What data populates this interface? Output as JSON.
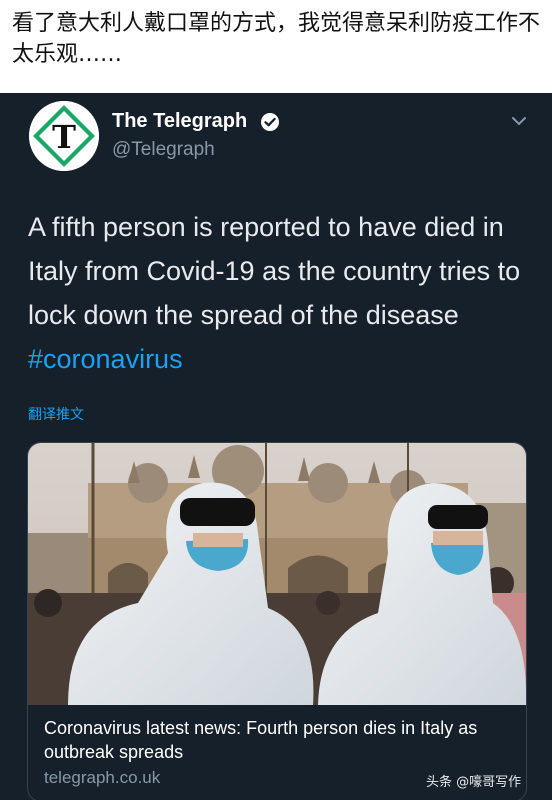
{
  "caption": "看了意大利人戴口罩的方式，我觉得意呆利防疫工作不太乐观……",
  "tweet": {
    "author_name": "The Telegraph",
    "author_handle": "@Telegraph",
    "avatar_letter": "T",
    "text": "A fifth person is reported to have died in Italy from Covid-19 as the country tries to lock down the spread of the disease ",
    "hashtag": "#coronavirus",
    "translate_label": "翻译推文",
    "card": {
      "title": "Coronavirus latest news: Fourth person dies in Italy as outbreak spreads",
      "domain": "telegraph.co.uk"
    }
  },
  "watermark": "头条 @嚎哥写作",
  "colors": {
    "tweet_bg": "#15202b",
    "link_blue": "#1da1f2",
    "muted": "#8899a6",
    "avatar_green": "#1aa86a"
  }
}
